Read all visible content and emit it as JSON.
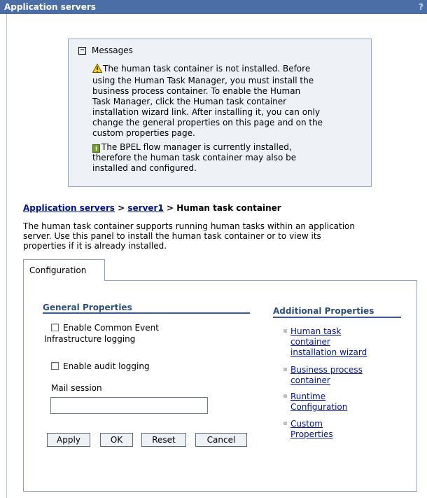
{
  "header": {
    "title": "Application servers",
    "help": "?"
  },
  "messages": {
    "header": "Messages",
    "collapse_symbol": "⊟",
    "items": [
      {
        "type": "warning",
        "icon": "warning-icon",
        "lines": [
          "The human task container is not installed. Before",
          "using the Human Task Manager, you must install the",
          "business process container. To enable the Human",
          "Task Manager, click the Human task container",
          "installation wizard link. After installing it, you can only",
          "change the general properties on this page and on the",
          "custom properties page."
        ]
      },
      {
        "type": "info",
        "icon": "info-icon",
        "icon_glyph": "i",
        "lines": [
          "The BPEL flow manager is currently installed,",
          "therefore the human task container may also be",
          "installed and configured."
        ]
      }
    ]
  },
  "breadcrumb": {
    "link1": "Application servers",
    "sep1": " > ",
    "link2": "server1",
    "sep2": " > ",
    "current": "Human task container"
  },
  "description": [
    "The human task container supports running human tasks within an application",
    "server. Use this panel to install the human task container or to view its",
    "properties if it is already installed."
  ],
  "tab": {
    "label": "Configuration"
  },
  "general_properties": {
    "title": "General Properties",
    "checkbox_cei_line1": "Enable Common Event",
    "checkbox_cei_line2": "Infrastructure logging",
    "checkbox_audit": "Enable audit logging",
    "mail_session_label": "Mail session",
    "mail_session_value": ""
  },
  "buttons": {
    "apply": "Apply",
    "ok": "OK",
    "reset": "Reset",
    "cancel": "Cancel"
  },
  "additional_properties": {
    "title": "Additional Properties",
    "links": [
      {
        "lines": [
          "Human task",
          "container",
          "installation wizard"
        ]
      },
      {
        "lines": [
          "Business process",
          "container"
        ]
      },
      {
        "lines": [
          "Runtime",
          "Configuration"
        ]
      },
      {
        "lines": [
          "Custom",
          "Properties"
        ]
      }
    ]
  },
  "colors": {
    "titlebar": "#4a6ea5",
    "message_bg": "#eef2f7",
    "link": "#00148a",
    "section_rule": "#385d8a"
  }
}
